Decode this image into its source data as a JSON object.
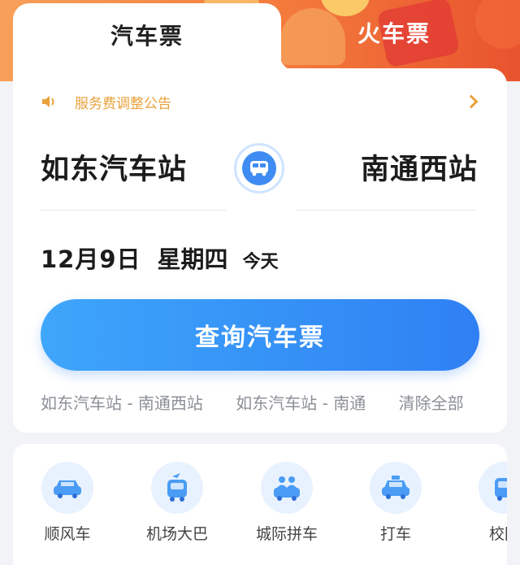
{
  "tabs": {
    "bus": "汽车票",
    "train": "火车票"
  },
  "notice": {
    "text": "服务费调整公告",
    "icon": "speaker-icon",
    "arrow_icon": "chevron-right-icon",
    "color": "#e9a13b"
  },
  "route": {
    "from": "如东汽车站",
    "to": "南通西站",
    "swap_icon": "bus-swap-icon"
  },
  "date": {
    "day": "12月9日",
    "weekday": "星期四",
    "relative": "今天"
  },
  "search": {
    "label": "查询汽车票",
    "color": "#2f80f3"
  },
  "history": {
    "items": [
      "如东汽车站 - 南通西站",
      "如东汽车站 - 南通"
    ],
    "clear_label": "清除全部"
  },
  "services": [
    {
      "label": "顺风车",
      "icon": "car-icon"
    },
    {
      "label": "机场大巴",
      "icon": "airport-bus-icon"
    },
    {
      "label": "城际拼车",
      "icon": "carpool-icon"
    },
    {
      "label": "打车",
      "icon": "taxi-icon"
    },
    {
      "label": "校园",
      "icon": "campus-bus-icon"
    }
  ]
}
